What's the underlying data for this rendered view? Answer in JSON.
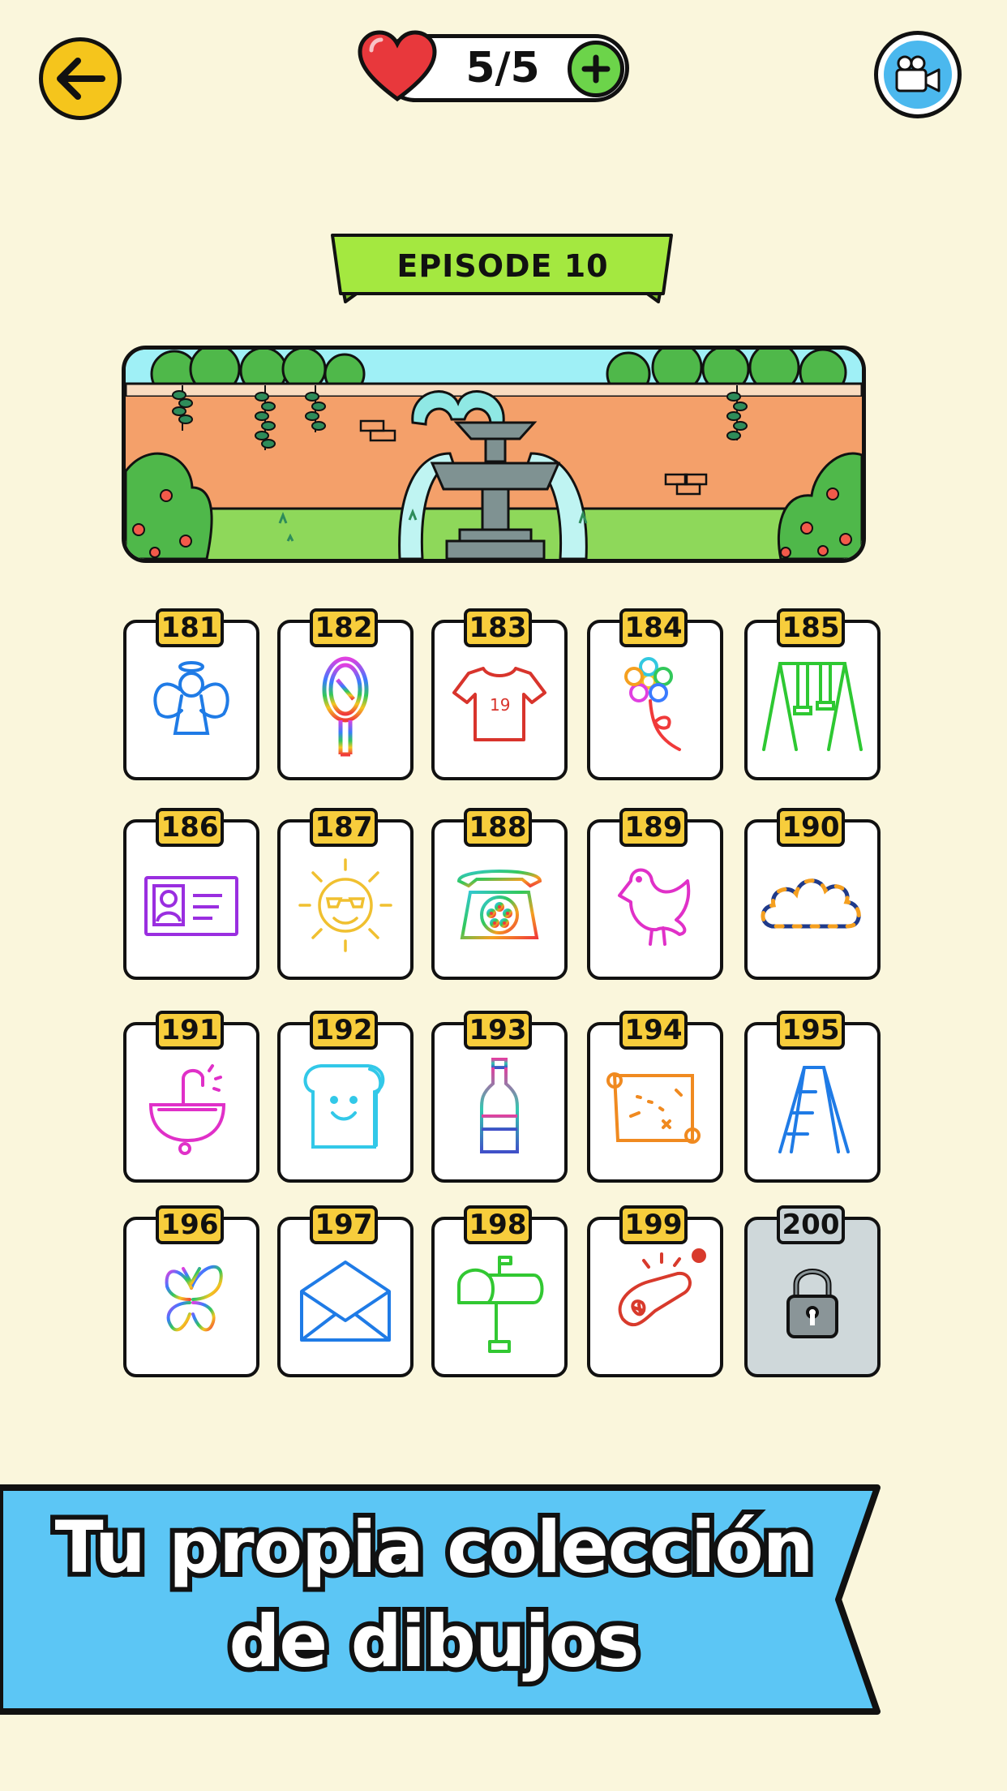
{
  "header": {
    "lives_text": "5/5",
    "back_icon": "arrow-left-icon",
    "video_icon": "video-camera-icon",
    "heart_icon": "heart-icon",
    "add_icon": "plus-icon"
  },
  "episode": {
    "title": "EPISODE 10"
  },
  "levels": [
    {
      "number": "181",
      "drawing": "angel",
      "locked": false
    },
    {
      "number": "182",
      "drawing": "hand-mirror",
      "locked": false
    },
    {
      "number": "183",
      "drawing": "t-shirt",
      "locked": false
    },
    {
      "number": "184",
      "drawing": "flower",
      "locked": false
    },
    {
      "number": "185",
      "drawing": "swing-set",
      "locked": false
    },
    {
      "number": "186",
      "drawing": "id-card",
      "locked": false
    },
    {
      "number": "187",
      "drawing": "sun-with-sunglasses",
      "locked": false
    },
    {
      "number": "188",
      "drawing": "rotary-telephone",
      "locked": false
    },
    {
      "number": "189",
      "drawing": "bird",
      "locked": false
    },
    {
      "number": "190",
      "drawing": "cloud",
      "locked": false
    },
    {
      "number": "191",
      "drawing": "sink",
      "locked": false
    },
    {
      "number": "192",
      "drawing": "bread-slice",
      "locked": false
    },
    {
      "number": "193",
      "drawing": "bottle",
      "locked": false
    },
    {
      "number": "194",
      "drawing": "treasure-map",
      "locked": false
    },
    {
      "number": "195",
      "drawing": "step-ladder",
      "locked": false
    },
    {
      "number": "196",
      "drawing": "butterfly",
      "locked": false
    },
    {
      "number": "197",
      "drawing": "envelope",
      "locked": false
    },
    {
      "number": "198",
      "drawing": "mailbox",
      "locked": false
    },
    {
      "number": "199",
      "drawing": "sausage",
      "locked": false
    },
    {
      "number": "200",
      "drawing": "lock-icon",
      "locked": true
    }
  ],
  "promo": {
    "line1": "Tu propia colección",
    "line2": "de dibujos"
  },
  "colors": {
    "background": "#faf6dc",
    "back_button": "#f5c51c",
    "level_tag": "#f7cd3c",
    "episode_ribbon": "#a4e840",
    "promo_banner": "#5cc6f5",
    "add_button": "#6cd44a",
    "heart": "#e8383c"
  }
}
